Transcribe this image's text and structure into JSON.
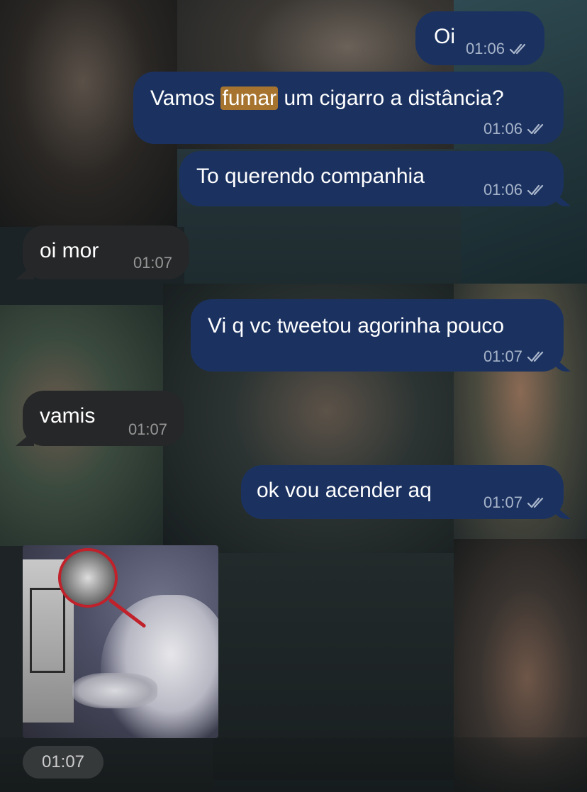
{
  "messages": [
    {
      "direction": "out",
      "text": "Oi",
      "time": "01:06",
      "status_icon": "double-check-icon"
    },
    {
      "direction": "out",
      "text_before": "Vamos ",
      "text_highlight": "fumar",
      "text_after": " um cigarro a distância?",
      "time": "01:06",
      "status_icon": "double-check-icon"
    },
    {
      "direction": "out",
      "text": "To querendo companhia",
      "time": "01:06",
      "status_icon": "double-check-icon"
    },
    {
      "direction": "in",
      "text": "oi mor",
      "time": "01:07"
    },
    {
      "direction": "out",
      "text": "Vi q vc tweetou agorinha pouco",
      "time": "01:07",
      "status_icon": "double-check-icon"
    },
    {
      "direction": "in",
      "text": "vamis",
      "time": "01:07"
    },
    {
      "direction": "out",
      "text": "ok vou acender aq",
      "time": "01:07",
      "status_icon": "double-check-icon"
    },
    {
      "direction": "in",
      "type": "image",
      "image_subject": "cat-meme-with-magnifier",
      "time": "01:07"
    }
  ],
  "colors": {
    "outgoing_bubble": "#1b3261",
    "incoming_bubble": "#262728",
    "search_highlight": "#a6742e"
  }
}
